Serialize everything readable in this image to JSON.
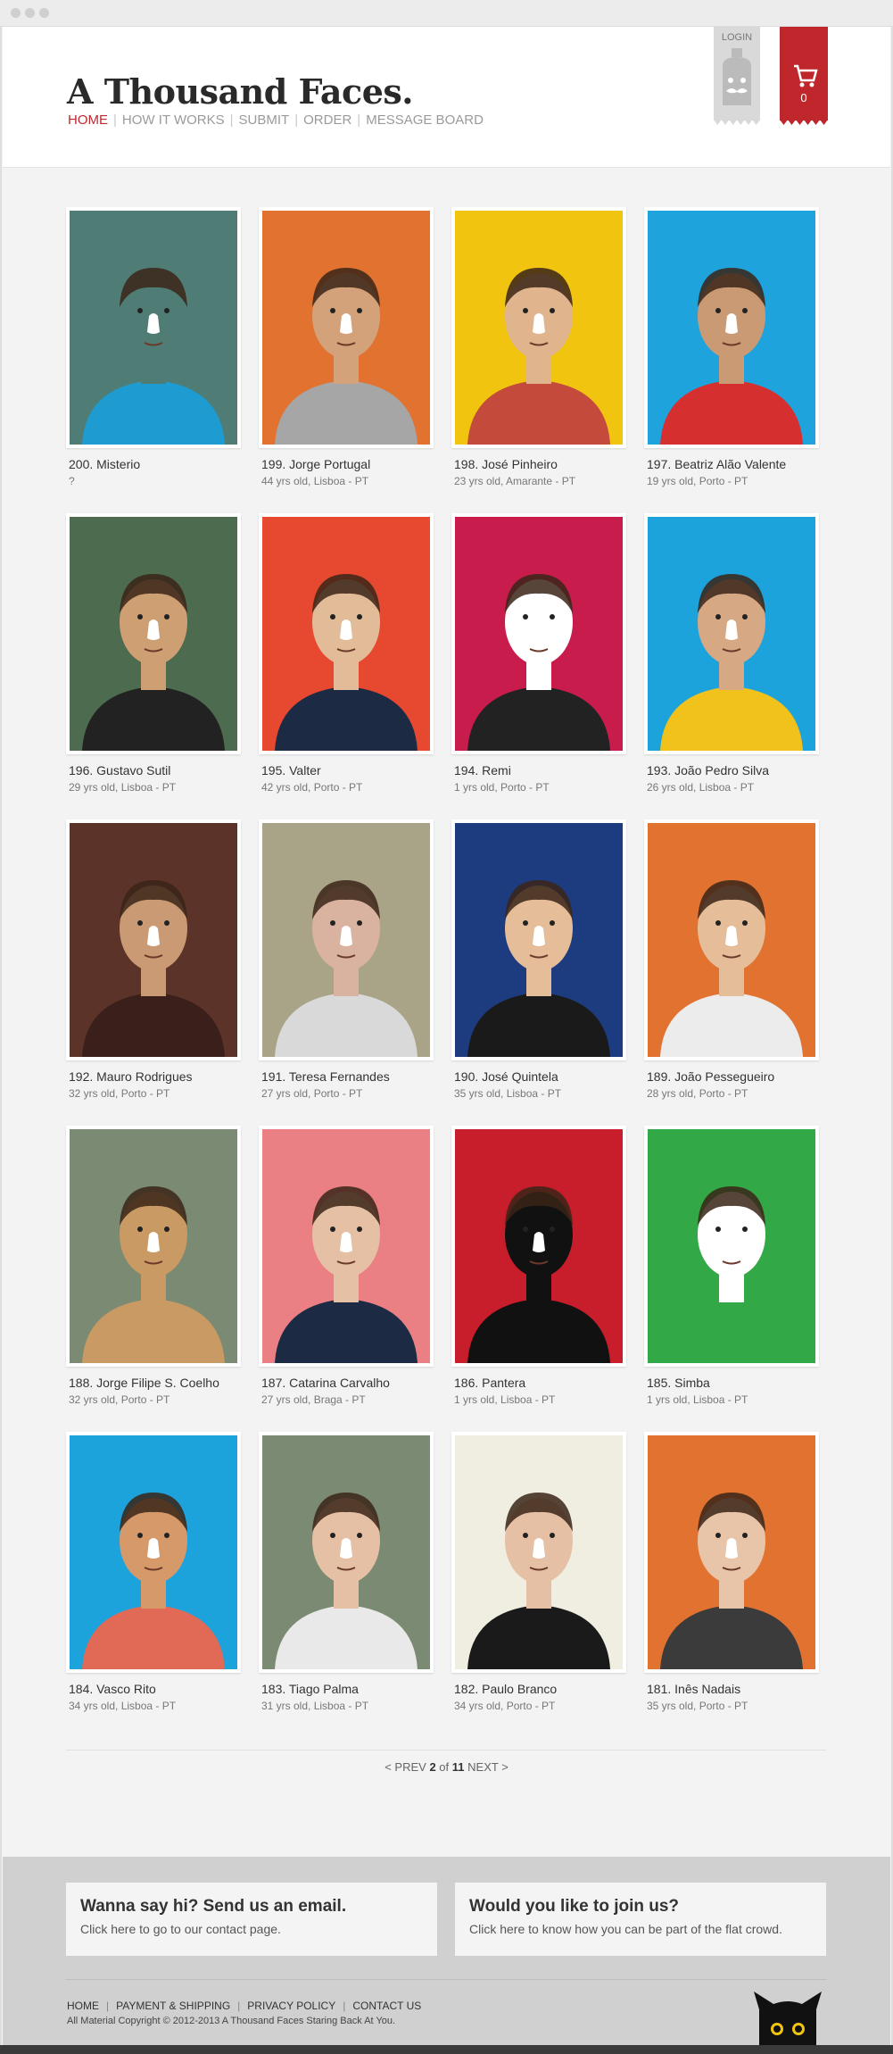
{
  "header": {
    "logo": "A Thousand Faces.",
    "nav": [
      {
        "label": "HOME",
        "active": true
      },
      {
        "label": "HOW IT WORKS"
      },
      {
        "label": "SUBMIT"
      },
      {
        "label": "ORDER"
      },
      {
        "label": "MESSAGE BOARD"
      }
    ],
    "login_label": "LOGIN",
    "cart_count": "0"
  },
  "faces": [
    {
      "name": "200. Misterio",
      "meta": "?",
      "bg": "#4f7d76",
      "skin": "#4f7d76",
      "shirt": "#1e9bd1"
    },
    {
      "name": "199. Jorge Portugal",
      "meta": "44 yrs old, Lisboa - PT",
      "bg": "#e27230",
      "skin": "#d3a27a",
      "shirt": "#a6a6a6"
    },
    {
      "name": "198. José Pinheiro",
      "meta": "23 yrs old, Amarante - PT",
      "bg": "#f1c40f",
      "skin": "#e0b58e",
      "shirt": "#c44a3b"
    },
    {
      "name": "197. Beatriz Alão Valente",
      "meta": "19 yrs old, Porto - PT",
      "bg": "#1fa3dc",
      "skin": "#c99a73",
      "shirt": "#d62f2f"
    },
    {
      "name": "196. Gustavo Sutil",
      "meta": "29 yrs old, Lisboa - PT",
      "bg": "#4d6b4f",
      "skin": "#cf9f74",
      "shirt": "#222"
    },
    {
      "name": "195. Valter",
      "meta": "42 yrs old, Porto - PT",
      "bg": "#e6492f",
      "skin": "#e2bb98",
      "shirt": "#1c2a44"
    },
    {
      "name": "194. Remi",
      "meta": "1 yrs old, Porto - PT",
      "bg": "#c81d4c",
      "skin": "#ffffff",
      "shirt": "#222"
    },
    {
      "name": "193. João Pedro Silva",
      "meta": "26 yrs old, Lisboa - PT",
      "bg": "#1da3dc",
      "skin": "#d6a884",
      "shirt": "#f0c21b"
    },
    {
      "name": "192. Mauro Rodrigues",
      "meta": "32 yrs old, Porto - PT",
      "bg": "#5b3328",
      "skin": "#c99a73",
      "shirt": "#3b1f1a"
    },
    {
      "name": "191. Teresa Fernandes",
      "meta": "27 yrs old, Porto - PT",
      "bg": "#a9a487",
      "skin": "#d9b3a0",
      "shirt": "#d9d9d9"
    },
    {
      "name": "190. José Quintela",
      "meta": "35 yrs old, Lisboa - PT",
      "bg": "#1d3c7f",
      "skin": "#e5bd98",
      "shirt": "#1a1a1a"
    },
    {
      "name": "189. João Pessegueiro",
      "meta": "28 yrs old, Porto - PT",
      "bg": "#e27230",
      "skin": "#e5bd98",
      "shirt": "#ececec"
    },
    {
      "name": "188. Jorge Filipe S. Coelho",
      "meta": "32 yrs old, Porto - PT",
      "bg": "#7b8a73",
      "skin": "#c99a63",
      "shirt": "#c99a63"
    },
    {
      "name": "187. Catarina Carvalho",
      "meta": "27 yrs old, Braga - PT",
      "bg": "#ea7f84",
      "skin": "#e5c0a4",
      "shirt": "#1c2a44"
    },
    {
      "name": "186. Pantera",
      "meta": "1 yrs old, Lisboa - PT",
      "bg": "#c81d2a",
      "skin": "#111111",
      "shirt": "#111"
    },
    {
      "name": "185. Simba",
      "meta": "1 yrs old, Lisboa - PT",
      "bg": "#32a846",
      "skin": "#ffffff",
      "shirt": "#32a846"
    },
    {
      "name": "184. Vasco Rito",
      "meta": "34 yrs old, Lisboa - PT",
      "bg": "#1da3dc",
      "skin": "#d69a6a",
      "shirt": "#e06a55"
    },
    {
      "name": "183. Tiago Palma",
      "meta": "31 yrs old, Lisboa - PT",
      "bg": "#7b8a73",
      "skin": "#e5c0a4",
      "shirt": "#e9e9e9"
    },
    {
      "name": "182. Paulo Branco",
      "meta": "34 yrs old, Porto - PT",
      "bg": "#efeee1",
      "skin": "#e5c0a4",
      "shirt": "#1a1a1a"
    },
    {
      "name": "181. Inês Nadais",
      "meta": "35 yrs old, Porto - PT",
      "bg": "#e27230",
      "skin": "#e8c4a8",
      "shirt": "#3b3b3b"
    }
  ],
  "pager": {
    "prev": "< PREV",
    "current": "2",
    "of": "of",
    "total": "11",
    "next": "NEXT >"
  },
  "footer": {
    "box1_title": "Wanna say hi? Send us an email.",
    "box1_sub": "Click here to go to our contact page.",
    "box2_title": "Would you like to join us?",
    "box2_sub": "Click here to know how you can be part of the flat crowd.",
    "links": [
      "HOME",
      "PAYMENT & SHIPPING",
      "PRIVACY POLICY",
      "CONTACT US"
    ],
    "copyright": "All Material Copyright © 2012-2013 A Thousand Faces Staring Back At You."
  }
}
